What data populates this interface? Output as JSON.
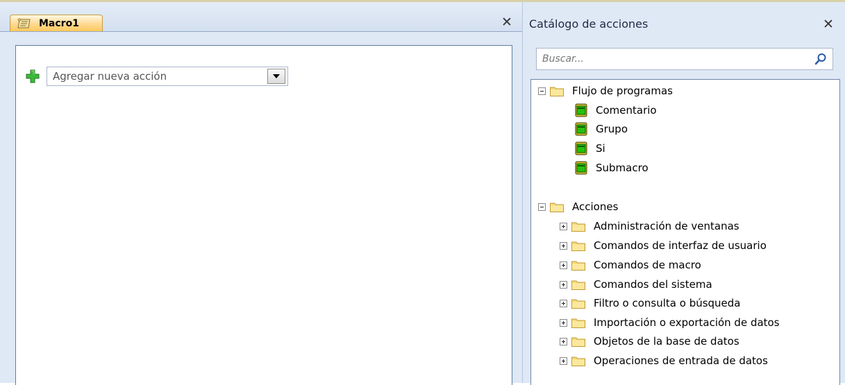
{
  "document_tab": {
    "title": "Macro1"
  },
  "macro_builder": {
    "add_action_placeholder": "Agregar nueva acción"
  },
  "catalog": {
    "title": "Catálogo de acciones",
    "search_placeholder": "Buscar...",
    "groups": [
      {
        "label": "Flujo de programas",
        "expanded": true,
        "items": [
          {
            "label": "Comentario",
            "icon": "program-flow-icon"
          },
          {
            "label": "Grupo",
            "icon": "program-flow-icon"
          },
          {
            "label": "Si",
            "icon": "program-flow-icon"
          },
          {
            "label": "Submacro",
            "icon": "program-flow-icon"
          }
        ]
      },
      {
        "label": "Acciones",
        "expanded": true,
        "items": [
          {
            "label": "Administración de ventanas",
            "icon": "folder-icon",
            "expanded": false
          },
          {
            "label": "Comandos de interfaz de usuario",
            "icon": "folder-icon",
            "expanded": false
          },
          {
            "label": "Comandos de macro",
            "icon": "folder-icon",
            "expanded": false
          },
          {
            "label": "Comandos del sistema",
            "icon": "folder-icon",
            "expanded": false
          },
          {
            "label": "Filtro o consulta o búsqueda",
            "icon": "folder-icon",
            "expanded": false
          },
          {
            "label": "Importación o exportación de datos",
            "icon": "folder-icon",
            "expanded": false
          },
          {
            "label": "Objetos de la base de datos",
            "icon": "folder-icon",
            "expanded": false
          },
          {
            "label": "Operaciones de entrada de datos",
            "icon": "folder-icon",
            "expanded": false
          }
        ]
      }
    ]
  },
  "colors": {
    "pane_background": "#dfe8f5",
    "tab_active": "#ffd992",
    "program_flow_icon": "#3fbf1f",
    "add_icon": "#2ea82e"
  }
}
